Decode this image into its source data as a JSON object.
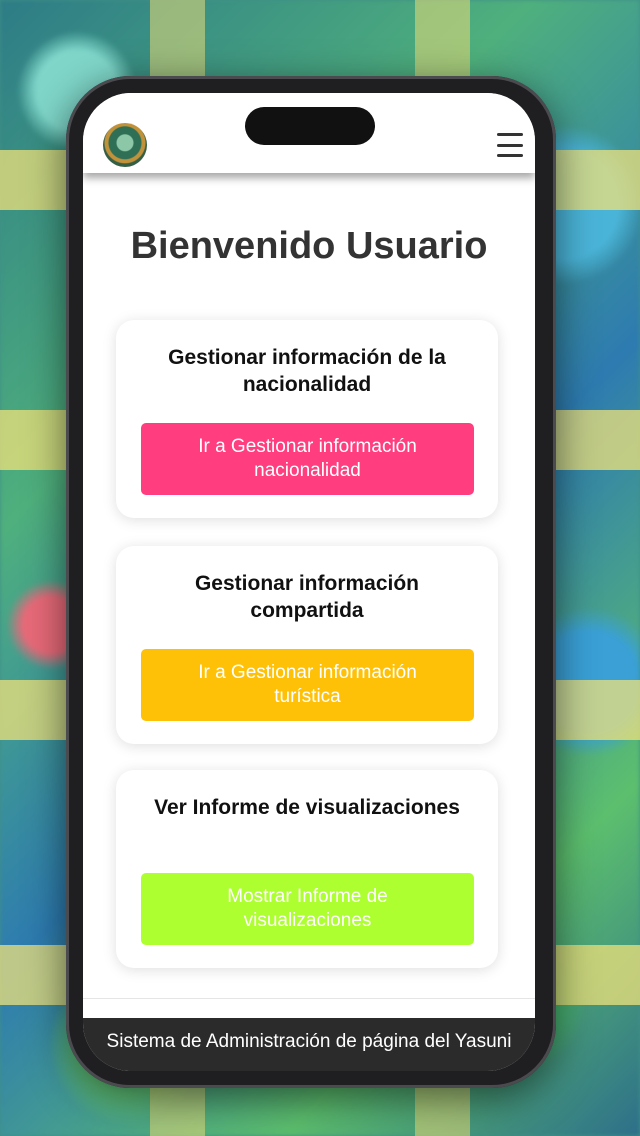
{
  "header": {
    "logo": "yasuni-logo",
    "menu_icon": "hamburger-menu-icon"
  },
  "page": {
    "title": "Bienvenido Usuario"
  },
  "cards": [
    {
      "title": "Gestionar información de la nacionalidad",
      "button_label": "Ir a Gestionar información nacionalidad",
      "button_color": "#ff3d7f"
    },
    {
      "title": "Gestionar información compartida",
      "button_label": "Ir a Gestionar información turística",
      "button_color": "#ffc107"
    },
    {
      "title": "Ver Informe de visualizaciones",
      "button_label": "Mostrar Informe de visualizaciones",
      "button_color": "#adff2f"
    }
  ],
  "footer": {
    "text": "Sistema de Administración de página del Yasuni"
  }
}
